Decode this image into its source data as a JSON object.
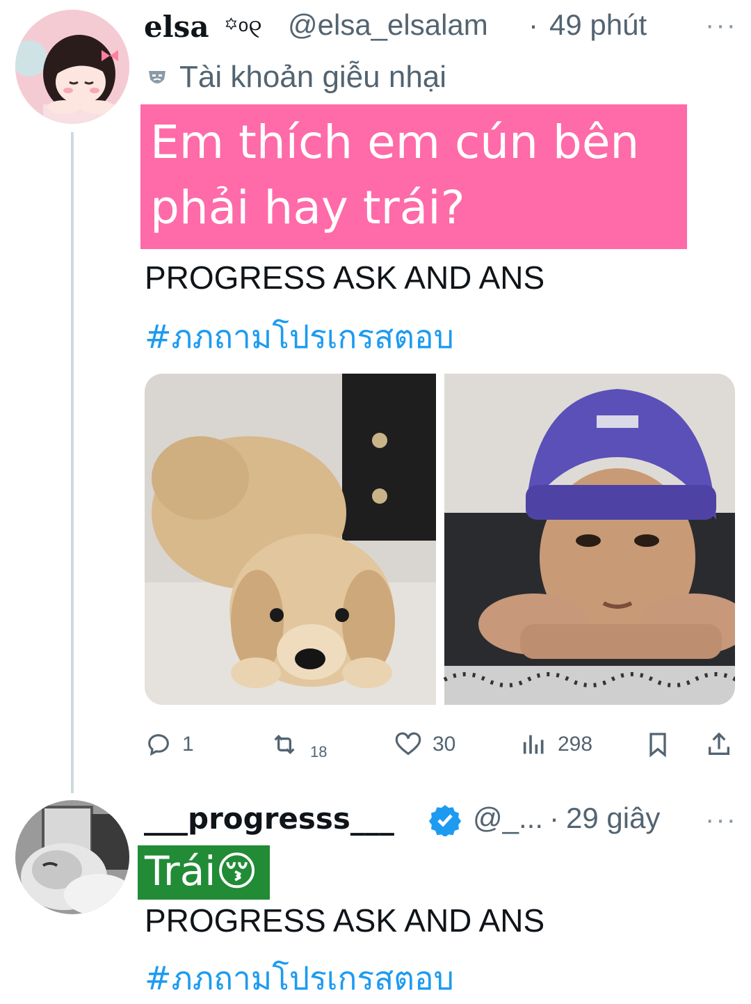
{
  "tweet1": {
    "display_name": "elsa",
    "name_decoration": "꙳ᵒ୧",
    "handle": "@elsa_elsalam",
    "separator": "·",
    "time": "49 phút",
    "more": "···",
    "parody_label": "Tài khoản giễu nhại",
    "highlight_text": "Em thích em cún bên phải hay trái?",
    "body_line": "PROGRESS ASK AND ANS",
    "hashtag": "#ภภถามโปรเกรสตอบ",
    "media": [
      {
        "icon": "puppy-photo"
      },
      {
        "icon": "person-beanie-photo"
      }
    ],
    "actions": {
      "reply_count": "1",
      "repost_count": "18",
      "like_count": "30",
      "views_count": "298"
    }
  },
  "tweet2": {
    "display_name": "___progresss___",
    "verified_icon": "verified-badge-icon",
    "handle": "@_...",
    "separator": "·",
    "time": "29 giây",
    "more": "···",
    "highlight_text": "Trái😚",
    "body_line": "PROGRESS ASK AND ANS",
    "hashtag": "#ภภถามโปรเกรสตอบ"
  },
  "colors": {
    "pink_highlight": "#ff6aa8",
    "green_highlight": "#218b36",
    "link_blue": "#1d9bf0",
    "muted_gray": "#536471"
  }
}
